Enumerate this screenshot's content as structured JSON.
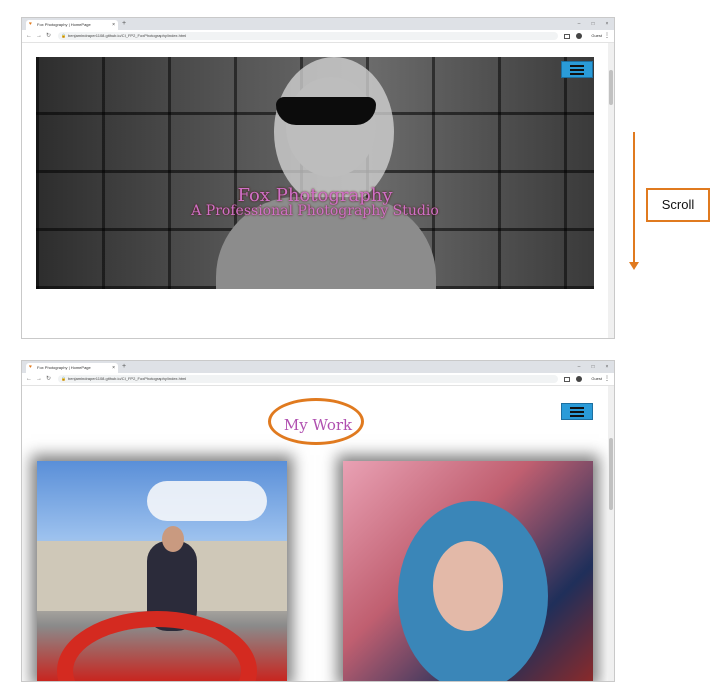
{
  "annotation": {
    "scroll_label": "Scroll",
    "accent": "#e07a1f"
  },
  "browser": {
    "tab_title": "Fox Photography | HomePage",
    "tab_close": "×",
    "new_tab": "+",
    "url": "benjamindraper1108.github.io/CI_FP2_FoxPhotography/index.html",
    "profile_label": "Guest",
    "window_controls": [
      "–",
      "□",
      "×"
    ]
  },
  "page_top": {
    "title": "Fox Photography",
    "subtitle": "A Professional Photography Studio",
    "title_color": "#d070c8",
    "menu_icon": "hamburger-icon",
    "menu_color": "#2a9bd8"
  },
  "page_scrolled": {
    "section_heading": "My Work",
    "heading_color": "#b050b0"
  }
}
